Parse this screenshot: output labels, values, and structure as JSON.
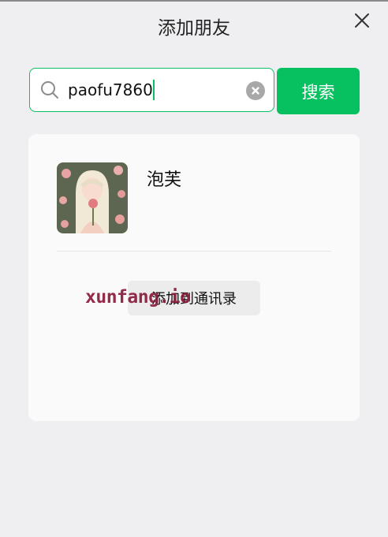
{
  "header": {
    "title": "添加朋友",
    "close_icon": "close-icon"
  },
  "search": {
    "value": "paofu7860",
    "placeholder": "",
    "search_icon": "search-icon",
    "clear_icon": "clear-icon",
    "button_label": "搜索"
  },
  "result": {
    "name": "泡芙",
    "avatar_icon": "avatar-image",
    "add_button_label": "添加到通讯录"
  },
  "watermark": "xunfang.io",
  "colors": {
    "accent": "#07c160",
    "background": "#efeff1",
    "card": "#fafafa"
  }
}
